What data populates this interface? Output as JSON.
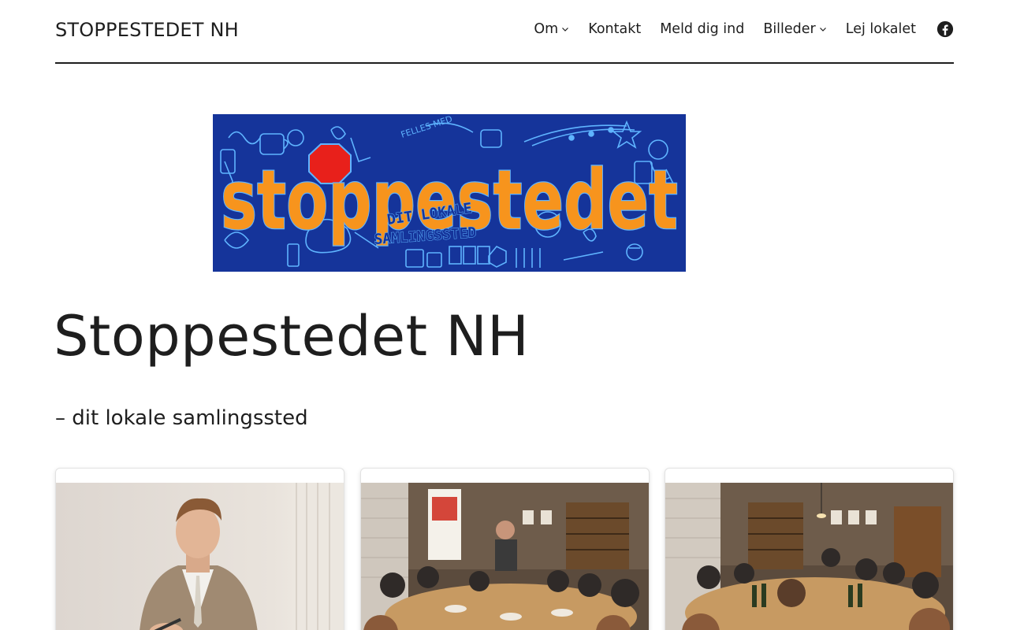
{
  "header": {
    "site_title": "STOPPESTEDET NH",
    "nav": [
      {
        "label": "Om",
        "has_submenu": true
      },
      {
        "label": "Kontakt",
        "has_submenu": false
      },
      {
        "label": "Meld dig ind",
        "has_submenu": false
      },
      {
        "label": "Billeder",
        "has_submenu": true
      },
      {
        "label": "Lej lokalet",
        "has_submenu": false
      }
    ],
    "social_icon": "facebook-icon"
  },
  "banner": {
    "wordmark": "stoppestedet",
    "subtext_line1": "DIT LOKALE",
    "subtext_line2": "SAMLINGSSTED",
    "arc_text": "FELLES MED",
    "colors": {
      "background": "#15349a",
      "lettering": "#f7941d",
      "doodles": "#5fb4ff",
      "dot": "#e8201b"
    }
  },
  "hero": {
    "title": "Stoppestedet NH",
    "tagline": "– dit lokale samlingssted"
  },
  "cards": [
    {
      "image": "man-in-suit-signing-photo"
    },
    {
      "image": "group-dinner-with-speaker-photo"
    },
    {
      "image": "group-dinner-wine-tasting-photo"
    }
  ]
}
